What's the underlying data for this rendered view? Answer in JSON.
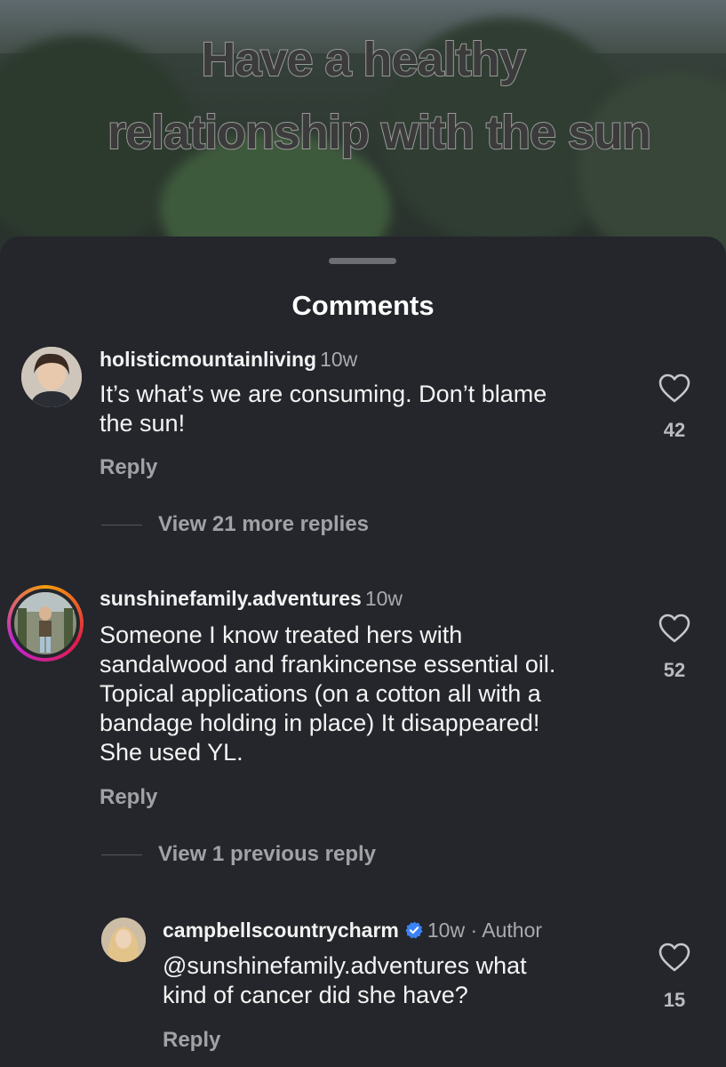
{
  "video": {
    "headline_line1": "Have a healthy",
    "headline_line2": "relationship with the sun"
  },
  "sheet": {
    "title": "Comments"
  },
  "comments": [
    {
      "username": "holisticmountainliving",
      "time": "10w",
      "text_line1": "It’s what’s we are consuming. Don’t blame",
      "text_line2": "the sun!",
      "reply_label": "Reply",
      "likes": "42",
      "view_replies": "View 21 more replies"
    },
    {
      "username": "sunshinefamily.adventures",
      "time": "10w",
      "text_line1": "Someone I know treated hers with",
      "text_line2": "sandalwood and frankincense essential oil.",
      "text_line3": "Topical applications (on a cotton all with a",
      "text_line4": "bandage holding in place) It disappeared!",
      "text_line5": "She used YL.",
      "reply_label": "Reply",
      "likes": "52",
      "view_replies": "View 1 previous reply"
    }
  ],
  "reply": {
    "username": "campbellscountrycharm",
    "time": "10w",
    "author_label": "· Author",
    "text_line1": "@sunshinefamily.adventures what",
    "text_line2": "kind of cancer did she have?",
    "reply_label": "Reply",
    "likes": "15"
  },
  "colors": {
    "background": "#24262b",
    "verified_badge": "#3b82f6"
  }
}
